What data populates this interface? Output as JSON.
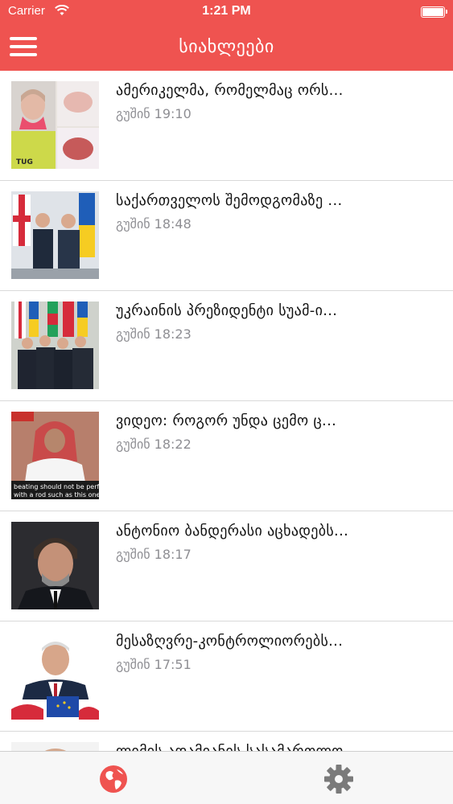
{
  "status_bar": {
    "carrier": "Carrier",
    "time": "1:21 PM"
  },
  "nav": {
    "title": "სიახლეები",
    "menu_icon": "hamburger-menu-icon"
  },
  "colors": {
    "accent": "#ef5350",
    "time_text": "#8e8e93",
    "tab_active": "#ef5350",
    "tab_inactive": "#7a7a7a"
  },
  "news": [
    {
      "title": "ამერიკელმა, რომელმაც ორს...",
      "time": "გუშინ 19:10"
    },
    {
      "title": "საქართველოს შემოდგომაზე ...",
      "time": "გუშინ 18:48"
    },
    {
      "title": "უკრაინის პრეზიდენტი სუამ-ი...",
      "time": "გუშინ 18:23"
    },
    {
      "title": "ვიდეო: როგორ უნდა ცემო ც...",
      "time": "გუშინ 18:22"
    },
    {
      "title": "ანტონიო ბანდერასი აცხადებს...",
      "time": "გუშინ 18:17"
    },
    {
      "title": "მესაზღვრე-კონტროლიორებს...",
      "time": "გუშინ 17:51"
    },
    {
      "title": "ლიმის ადამიანის სასამართლო",
      "time": ""
    }
  ],
  "thumbnail_captions": {
    "video_caption": "beating should not be perfor with a rod such as this one."
  },
  "tabs": [
    {
      "name": "news",
      "icon": "globe-icon",
      "active": true
    },
    {
      "name": "settings",
      "icon": "gear-icon",
      "active": false
    }
  ]
}
